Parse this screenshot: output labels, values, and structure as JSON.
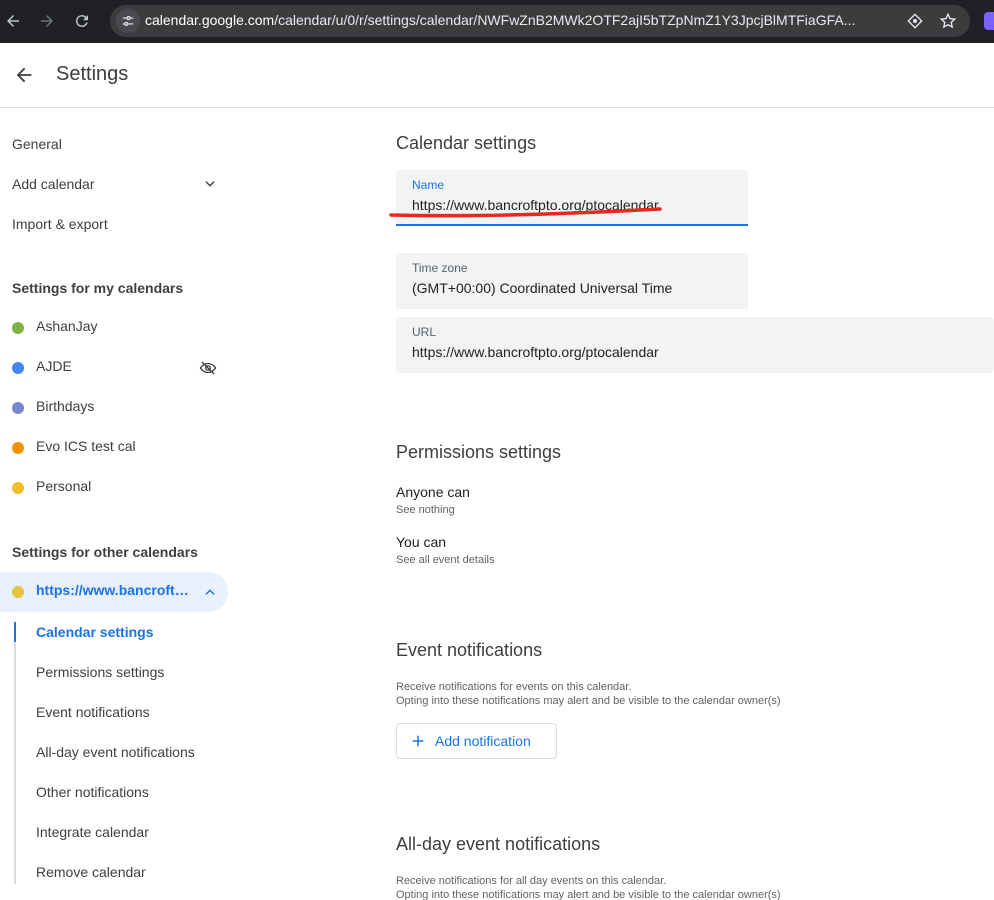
{
  "browser": {
    "url_host": "calendar.google.com",
    "url_path": "/calendar/u/0/r/settings/calendar/NWFwZnB2MWk2OTF2ajI5bTZpNmZ1Y3JpcjBlMTFiaGFA..."
  },
  "header": {
    "title": "Settings"
  },
  "sidebar": {
    "general": "General",
    "add_calendar": "Add calendar",
    "import_export": "Import & export",
    "my_calendars_heading": "Settings for my calendars",
    "my_calendars": [
      {
        "name": "AshanJay",
        "color": "#7cb342"
      },
      {
        "name": "AJDE",
        "color": "#4285f4"
      },
      {
        "name": "Birthdays",
        "color": "#7986cb"
      },
      {
        "name": "Evo ICS test cal",
        "color": "#f09300"
      },
      {
        "name": "Personal",
        "color": "#f6bf26"
      }
    ],
    "other_calendars_heading": "Settings for other calendars",
    "other_calendar": {
      "name": "https://www.bancroftpto.org/ptocalendar",
      "color": "#e4c441"
    },
    "sub_items": [
      "Calendar settings",
      "Permissions settings",
      "Event notifications",
      "All-day event notifications",
      "Other notifications",
      "Integrate calendar",
      "Remove calendar"
    ]
  },
  "main": {
    "calendar_settings": {
      "title": "Calendar settings",
      "name_label": "Name",
      "name_value": "https://www.bancroftpto.org/ptocalendar",
      "timezone_label": "Time zone",
      "timezone_value": "(GMT+00:00) Coordinated Universal Time",
      "url_label": "URL",
      "url_value": "https://www.bancroftpto.org/ptocalendar"
    },
    "permissions": {
      "title": "Permissions settings",
      "anyone_label": "Anyone can",
      "anyone_value": "See nothing",
      "you_label": "You can",
      "you_value": "See all event details"
    },
    "event_notifications": {
      "title": "Event notifications",
      "desc1": "Receive notifications for events on this calendar.",
      "desc2": "Opting into these notifications may alert and be visible to the calendar owner(s)",
      "add_button": "Add notification"
    },
    "allday_notifications": {
      "title": "All-day event notifications",
      "desc1": "Receive notifications for all day events on this calendar.",
      "desc2": "Opting into these notifications may alert and be visible to the calendar owner(s)"
    }
  },
  "colors": {
    "accent": "#1a73e8",
    "annotation": "#e8291c"
  },
  "icons": [
    "back-icon",
    "forward-icon",
    "reload-icon",
    "site-settings-icon",
    "extension-icon",
    "star-icon",
    "arrow-back-icon",
    "chevron-down-icon",
    "chevron-up-icon",
    "visibility-off-icon",
    "plus-icon"
  ]
}
